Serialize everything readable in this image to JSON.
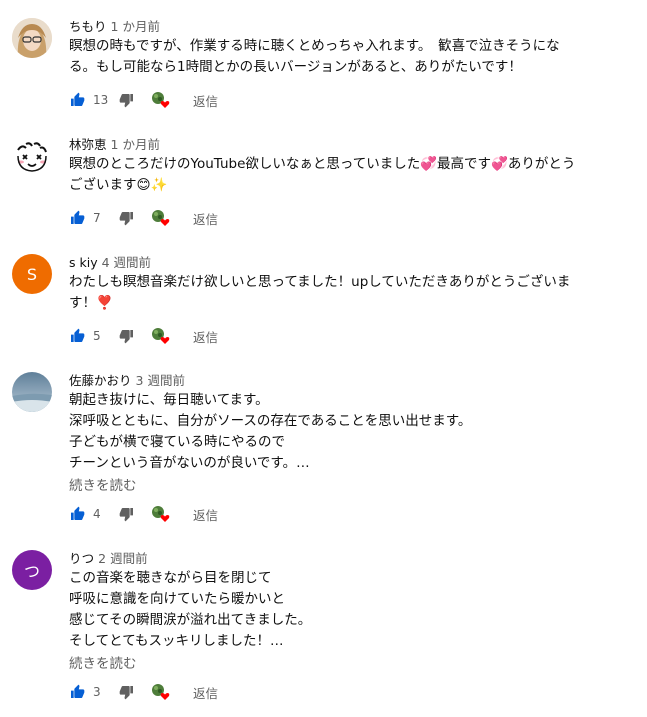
{
  "comments": [
    {
      "author": "ちもり",
      "time": "1 か月前",
      "avatar_letter": "",
      "text": "瞑想の時もですが、作業する時に聴くとめっちゃ入れます。　歓喜で泣きそうにな\nる。もし可能なら1時間とかの長いバージョンがあると、ありがたいです！",
      "likes": "13",
      "reply": "返信"
    },
    {
      "author": "林弥恵",
      "time": "1 か月前",
      "avatar_letter": "",
      "text": "瞑想のところだけのYouTube欲しいなぁと思っていました💞最高です💞ありがとう\nございます😊✨",
      "likes": "7",
      "reply": "返信"
    },
    {
      "author": "s kiy",
      "time": "4 週間前",
      "avatar_letter": "S",
      "text": "わたしも瞑想音楽だけ欲しいと思ってました！upしていただきありがとうございま\nす！❣️",
      "likes": "5",
      "reply": "返信"
    },
    {
      "author": "佐藤かおり",
      "time": "3 週間前",
      "avatar_letter": "",
      "text": "朝起き抜けに、毎日聴いてます。\n深呼吸とともに、自分がソースの存在であることを思い出せます。\n子どもが横で寝ている時にやるので\nチーンという音がないのが良いです。…",
      "more": "続きを読む",
      "likes": "4",
      "reply": "返信"
    },
    {
      "author": "りつ",
      "time": "2 週間前",
      "avatar_letter": "つ",
      "text": "この音楽を聴きながら目を閉じて\n呼吸に意識を向けていたら暖かいと\n感じてその瞬間涙が溢れ出てきました。\nそしてとてもスッキリしました！…",
      "more": "続きを読む",
      "likes": "3",
      "reply": "返信"
    }
  ],
  "colors": {
    "avatar_s": "#ef6c00",
    "avatar_tsu": "#7b1fa2",
    "like_blue": "#065fd4",
    "heart_red": "#ff0000"
  }
}
